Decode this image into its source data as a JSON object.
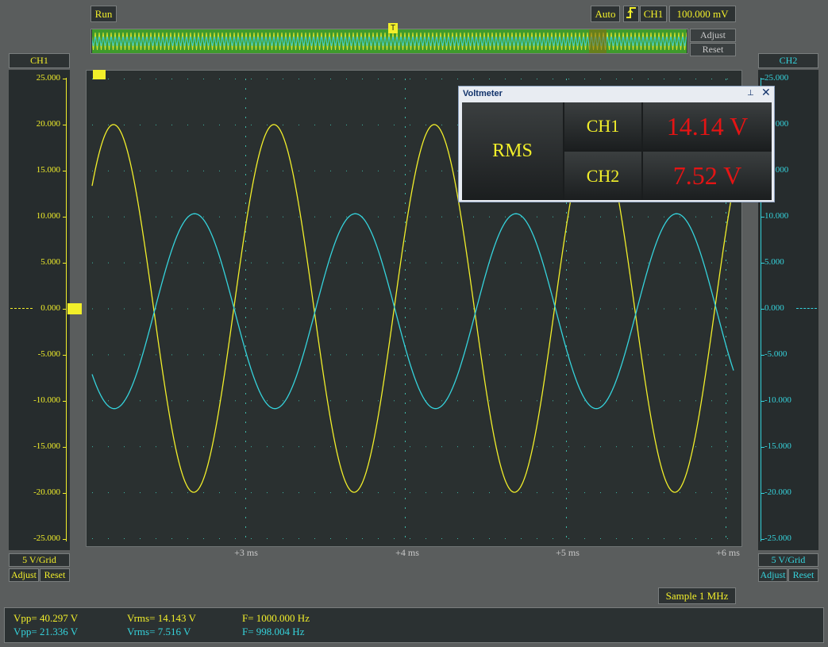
{
  "toolbar": {
    "run_label": "Run",
    "mode_label": "Auto",
    "trigger_channel": "CH1",
    "trigger_level": "100.000 mV",
    "adjust_label": "Adjust",
    "reset_label": "Reset"
  },
  "left_axis": {
    "channel": "CH1",
    "color": "#f2ef2a",
    "ticks": [
      "25.000",
      "20.000",
      "15.000",
      "10.000",
      "5.000",
      "0.000",
      "-5.000",
      "-10.000",
      "-15.000",
      "-20.000",
      "-25.000"
    ],
    "scale": "5 V/Grid",
    "adjust_label": "Adjust",
    "reset_label": "Reset"
  },
  "right_axis": {
    "channel": "CH2",
    "color": "#35d3dc",
    "ticks": [
      "25.000",
      "20.000",
      "15.000",
      "10.000",
      "5.000",
      "0.000",
      "-5.000",
      "-10.000",
      "-15.000",
      "-20.000",
      "-25.000"
    ],
    "scale": "5 V/Grid",
    "adjust_label": "Adjust",
    "reset_label": "Reset"
  },
  "time_axis": {
    "labels": [
      "+3 ms",
      "+4 ms",
      "+5 ms",
      "+6 ms"
    ]
  },
  "chart_data": {
    "type": "line",
    "xlabel": "",
    "ylabel": "",
    "ylim": [
      -25,
      25
    ],
    "grid": true,
    "series": [
      {
        "name": "CH1",
        "color": "#f2ef2a",
        "amplitude": 20.0,
        "offset": 0.0,
        "frequency_hz": 1000.0,
        "phase_deg": 0
      },
      {
        "name": "CH2",
        "color": "#35d3dc",
        "amplitude": 10.6,
        "offset": -0.3,
        "frequency_hz": 998.004,
        "phase_deg": 180
      }
    ]
  },
  "voltmeter": {
    "title": "Voltmeter",
    "mode_label": "RMS",
    "rows": [
      {
        "channel": "CH1",
        "value": "14.14 V"
      },
      {
        "channel": "CH2",
        "value": "7.52 V"
      }
    ]
  },
  "sample_rate": "Sample 1 MHz",
  "measurements": [
    {
      "vpp": "Vpp= 40.297 V",
      "vrms": "Vrms= 14.143 V",
      "freq": "F= 1000.000 Hz",
      "color": "#f2ef2a"
    },
    {
      "vpp": "Vpp= 21.336 V",
      "vrms": "Vrms= 7.516 V",
      "freq": "F= 998.004 Hz",
      "color": "#35d3dc"
    }
  ]
}
